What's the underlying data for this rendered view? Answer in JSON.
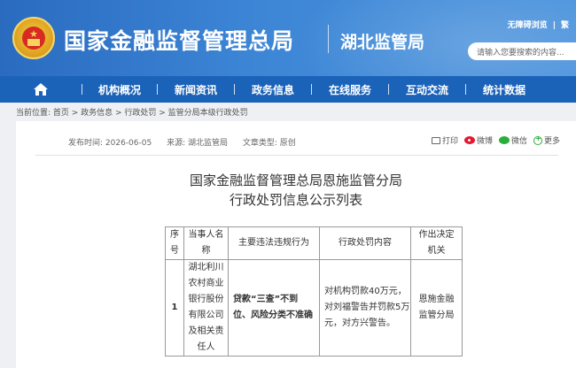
{
  "header": {
    "site_title": "国家金融监督管理总局",
    "sub_title": "湖北监管局",
    "accessibility_link": "无障碍浏览",
    "lang_link": "繁",
    "search_placeholder": "请输入您要搜索的内容..."
  },
  "nav": {
    "items": [
      {
        "label": "机构概况"
      },
      {
        "label": "新闻资讯"
      },
      {
        "label": "政务信息"
      },
      {
        "label": "在线服务"
      },
      {
        "label": "互动交流"
      },
      {
        "label": "统计数据"
      }
    ]
  },
  "breadcrumb": "当前位置:  首页 > 政务信息 > 行政处罚 > 监管分局本级行政处罚",
  "article": {
    "publish_time": "发布时间:  2026-06-05",
    "source": "来源:  湖北监管局",
    "type": "文章类型:  原创",
    "share": {
      "print": "打印",
      "weibo": "微博",
      "wechat": "微信",
      "more": "更多"
    },
    "title_line1": "国家金融监督管理总局恩施监管分局",
    "title_line2": "行政处罚信息公示列表"
  },
  "table": {
    "headers": {
      "seq": [
        "序",
        "号"
      ],
      "party": [
        "当事人名",
        "称"
      ],
      "violation": "主要违法违规行为",
      "penalty": "行政处罚内容",
      "authority": [
        "作出决定",
        "机关"
      ]
    },
    "rows": [
      {
        "seq": "1",
        "party": [
          "湖北利川",
          "农村商业",
          "银行股份",
          "有限公司",
          "及相关责",
          "任人"
        ],
        "violation": [
          "贷款“三查”不到",
          "位、风险分类不准确"
        ],
        "penalty": [
          "对机构罚款40万元，",
          "对刘福警告并罚款5万",
          "元，对方兴警告。"
        ],
        "authority": [
          "恩施金融",
          "监管分局"
        ]
      }
    ]
  }
}
